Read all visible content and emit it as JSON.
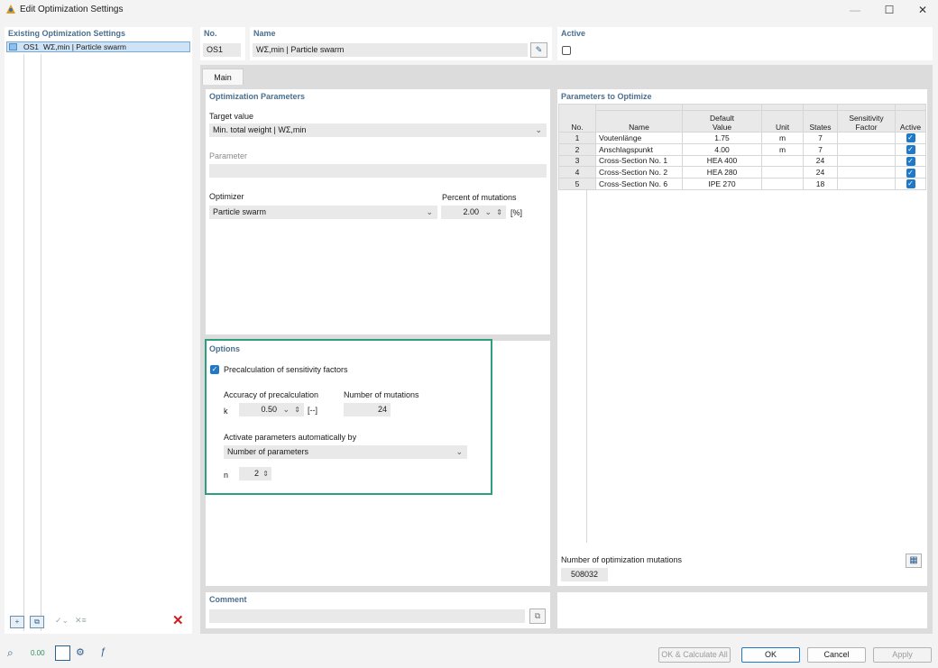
{
  "window": {
    "title": "Edit Optimization Settings",
    "minimize_glyph": "—",
    "maximize_glyph": "☐",
    "close_glyph": "✕"
  },
  "left": {
    "header": "Existing Optimization Settings",
    "items": [
      {
        "no": "OS1",
        "name": "WΣ,min | Particle swarm"
      }
    ],
    "bottom_icons": [
      "new-icon",
      "copy-icon",
      "check-icon",
      "uncheck-icon",
      "delete-icon"
    ]
  },
  "head": {
    "no_label": "No.",
    "no_value": "OS1",
    "name_label": "Name",
    "name_value": "WΣ,min | Particle swarm",
    "active_label": "Active"
  },
  "tabs": [
    "Main"
  ],
  "opt_params": {
    "title": "Optimization Parameters",
    "target_label": "Target value",
    "target_value": "Min. total weight | WΣ,min",
    "parameter_label": "Parameter",
    "parameter_value": "",
    "optimizer_label": "Optimizer",
    "optimizer_value": "Particle swarm",
    "mutations_label": "Percent of mutations",
    "mutations_value": "2.00",
    "mutations_unit": "[%]"
  },
  "options": {
    "title": "Options",
    "precalc_label": "Precalculation of sensitivity factors",
    "precalc_checked": true,
    "accuracy_label": "Accuracy of precalculation",
    "accuracy_symbol": "k",
    "accuracy_value": "0.50",
    "accuracy_unit": "[--]",
    "num_mut_label": "Number of mutations",
    "num_mut_value": "24",
    "activate_label": "Activate parameters automatically by",
    "activate_value": "Number of parameters",
    "n_symbol": "n",
    "n_value": "2",
    "highlight_color": "#2e9e7e"
  },
  "params_table": {
    "title": "Parameters to Optimize",
    "headers": {
      "no": "No.",
      "name": "Name",
      "default_value_1": "Default",
      "default_value_2": "Value",
      "unit": "Unit",
      "states": "States",
      "sens_1": "Sensitivity",
      "sens_2": "Factor",
      "active": "Active"
    },
    "rows": [
      {
        "no": "1",
        "name": "Voutenlänge",
        "value": "1.75",
        "unit": "m",
        "states": "7",
        "factor": "",
        "active": true
      },
      {
        "no": "2",
        "name": "Anschlagspunkt",
        "value": "4.00",
        "unit": "m",
        "states": "7",
        "factor": "",
        "active": true
      },
      {
        "no": "3",
        "name": "Cross-Section No. 1",
        "value": "HEA 400",
        "unit": "",
        "states": "24",
        "factor": "",
        "active": true
      },
      {
        "no": "4",
        "name": "Cross-Section No. 2",
        "value": "HEA 280",
        "unit": "",
        "states": "24",
        "factor": "",
        "active": true
      },
      {
        "no": "5",
        "name": "Cross-Section No. 6",
        "value": "IPE 270",
        "unit": "",
        "states": "18",
        "factor": "",
        "active": true
      }
    ],
    "total_label": "Number of optimization mutations",
    "total_value": "508032"
  },
  "comment": {
    "label": "Comment",
    "value": ""
  },
  "footer": {
    "buttons": {
      "calc_all": "OK & Calculate All",
      "ok": "OK",
      "cancel": "Cancel",
      "apply": "Apply"
    },
    "icons": [
      "search-icon",
      "decimal-icon",
      "color-box-icon",
      "settings-icon",
      "function-icon"
    ]
  }
}
